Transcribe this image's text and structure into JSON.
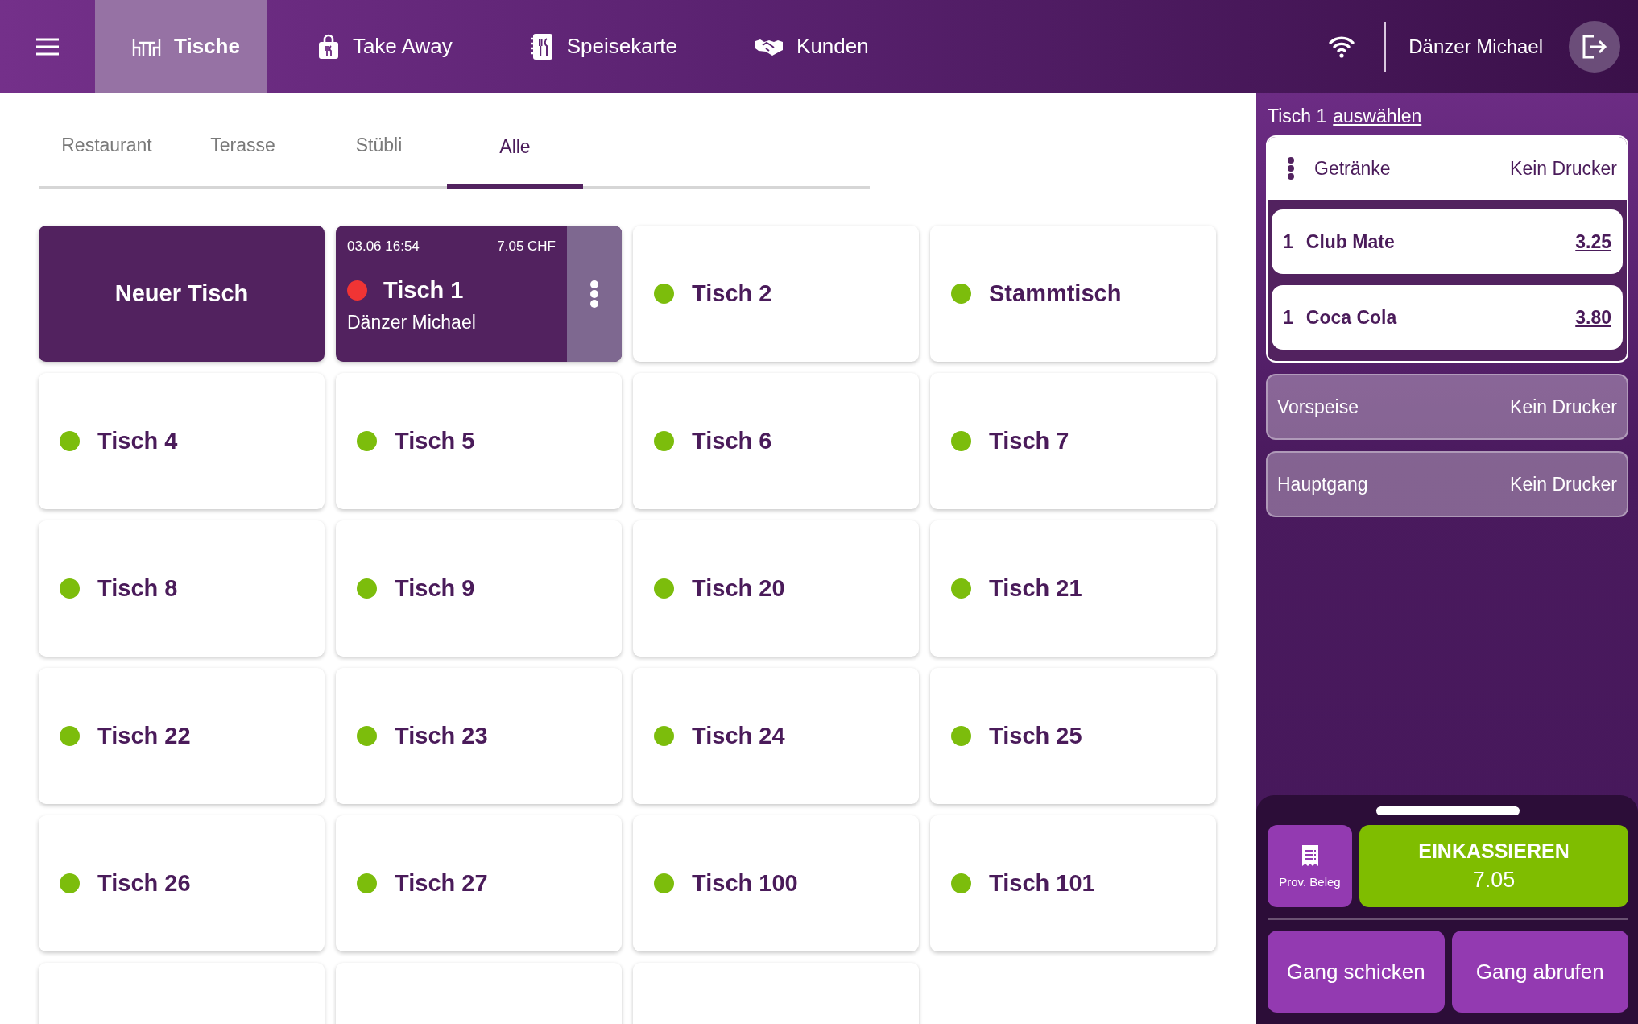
{
  "nav": {
    "items": [
      {
        "label": "Tische",
        "selected": true
      },
      {
        "label": "Take Away",
        "selected": false
      },
      {
        "label": "Speisekarte",
        "selected": false
      },
      {
        "label": "Kunden",
        "selected": false
      }
    ]
  },
  "user": "Dänzer Michael",
  "area_tabs": [
    {
      "label": "Restaurant",
      "selected": false
    },
    {
      "label": "Terasse",
      "selected": false
    },
    {
      "label": "Stübli",
      "selected": false
    },
    {
      "label": "Alle",
      "selected": true
    }
  ],
  "tiles": [
    {
      "kind": "new",
      "label": "Neuer Tisch"
    },
    {
      "kind": "occupied",
      "label": "Tisch 1",
      "time": "03.06 16:54",
      "amount": "7.05 CHF",
      "waiter": "Dänzer Michael",
      "color": "#f03434"
    },
    {
      "kind": "free",
      "label": "Tisch 2",
      "color": "#7cbd0c"
    },
    {
      "kind": "free",
      "label": "Stammtisch",
      "color": "#7cbd0c"
    },
    {
      "kind": "free",
      "label": "Tisch 4",
      "color": "#7cbd0c"
    },
    {
      "kind": "free",
      "label": "Tisch 5",
      "color": "#7cbd0c"
    },
    {
      "kind": "free",
      "label": "Tisch 6",
      "color": "#7cbd0c"
    },
    {
      "kind": "free",
      "label": "Tisch 7",
      "color": "#7cbd0c"
    },
    {
      "kind": "free",
      "label": "Tisch 8",
      "color": "#7cbd0c"
    },
    {
      "kind": "free",
      "label": "Tisch 9",
      "color": "#7cbd0c"
    },
    {
      "kind": "free",
      "label": "Tisch 20",
      "color": "#7cbd0c"
    },
    {
      "kind": "free",
      "label": "Tisch 21",
      "color": "#7cbd0c"
    },
    {
      "kind": "free",
      "label": "Tisch 22",
      "color": "#7cbd0c"
    },
    {
      "kind": "free",
      "label": "Tisch 23",
      "color": "#7cbd0c"
    },
    {
      "kind": "free",
      "label": "Tisch 24",
      "color": "#7cbd0c"
    },
    {
      "kind": "free",
      "label": "Tisch 25",
      "color": "#7cbd0c"
    },
    {
      "kind": "free",
      "label": "Tisch 26",
      "color": "#7cbd0c"
    },
    {
      "kind": "free",
      "label": "Tisch 27",
      "color": "#7cbd0c"
    },
    {
      "kind": "free",
      "label": "Tisch 100",
      "color": "#7cbd0c"
    },
    {
      "kind": "free",
      "label": "Tisch 101",
      "color": "#7cbd0c"
    },
    {
      "kind": "blank"
    },
    {
      "kind": "blank"
    },
    {
      "kind": "blank"
    }
  ],
  "order_panel": {
    "table": "Tisch 1",
    "link": "auswählen",
    "courses": [
      {
        "name": "Getränke",
        "printer": "Kein Drucker",
        "expanded": true,
        "items": [
          {
            "qty": "1",
            "name": "Club Mate",
            "price": "3.25"
          },
          {
            "qty": "1",
            "name": "Coca Cola",
            "price": "3.80"
          }
        ]
      },
      {
        "name": "Vorspeise",
        "printer": "Kein Drucker",
        "expanded": false
      },
      {
        "name": "Hauptgang",
        "printer": "Kein Drucker",
        "expanded": false
      }
    ]
  },
  "actions": {
    "receipt": "Prov. Beleg",
    "checkout": "EINKASSIEREN",
    "total": "7.05",
    "buttons": [
      "Gang schicken",
      "Gang abrufen"
    ]
  }
}
